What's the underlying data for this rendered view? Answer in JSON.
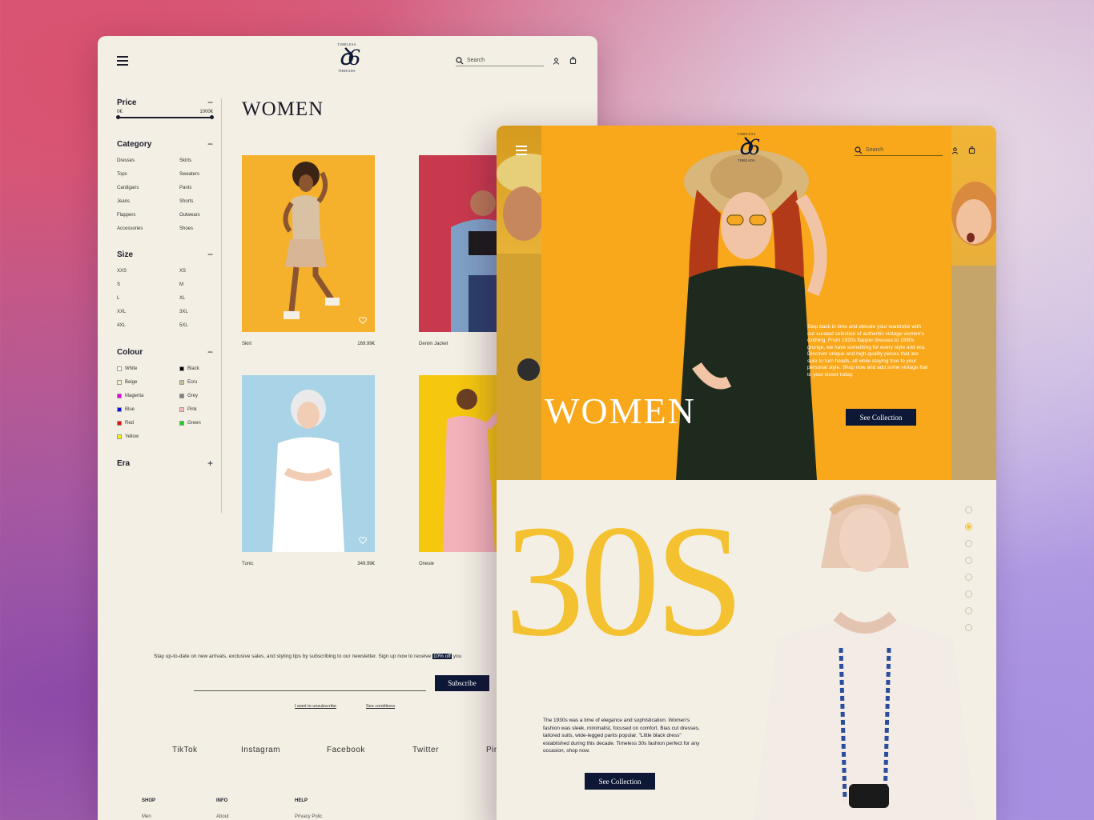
{
  "back": {
    "header": {
      "logo_top": "TIMELESS",
      "logo_mark": "ꝺ6",
      "logo_bottom": "THREADS",
      "search_placeholder": "Search"
    },
    "filters": {
      "price": {
        "title": "Price",
        "toggle": "−",
        "min": "0€",
        "max": "1000€"
      },
      "category": {
        "title": "Category",
        "toggle": "−",
        "items": [
          "Dresses",
          "Skirts",
          "Tops",
          "Sweaters",
          "Cardigans",
          "Pants",
          "Jeans",
          "Shorts",
          "Flappers",
          "Outwears",
          "Accessories",
          "Shoes"
        ]
      },
      "size": {
        "title": "Size",
        "toggle": "−",
        "items": [
          "XXS",
          "XS",
          "S",
          "M",
          "L",
          "XL",
          "XXL",
          "3XL",
          "4XL",
          "5XL"
        ]
      },
      "colour": {
        "title": "Colour",
        "toggle": "−",
        "items": [
          {
            "label": "White",
            "color": "#ffffff"
          },
          {
            "label": "Black",
            "color": "#000000"
          },
          {
            "label": "Beige",
            "color": "#f2ead2"
          },
          {
            "label": "Ecru",
            "color": "#c9bf9a"
          },
          {
            "label": "Magenta",
            "color": "#e000d8"
          },
          {
            "label": "Grey",
            "color": "#808080"
          },
          {
            "label": "Blue",
            "color": "#0a10e0"
          },
          {
            "label": "Pink",
            "color": "#f6b9c8"
          },
          {
            "label": "Red",
            "color": "#e01010"
          },
          {
            "label": "Green",
            "color": "#19d219"
          },
          {
            "label": "Yellow",
            "color": "#f5f218"
          }
        ]
      },
      "era": {
        "title": "Era",
        "toggle": "+"
      }
    },
    "category_title": "WOMEN",
    "products": [
      {
        "name": "Skirt",
        "price": "169.99€",
        "bg": "#f6b12c"
      },
      {
        "name": "Denim Jacket",
        "price": "",
        "bg": "#c8394e"
      },
      {
        "name": "Tunic",
        "price": "349.99€",
        "bg": "#a9d3e6"
      },
      {
        "name": "Onesie",
        "price": "",
        "bg": "#f5c70f"
      }
    ],
    "newsletter": {
      "text": "Stay up-to-date on new arrivals, exclusive sales, and styling tips by subscribing to our newsletter. Sign up now to receive",
      "highlight": "10% off",
      "tail": "you",
      "subscribe": "Subscribe",
      "unsubscribe": "I want to unsubscribe",
      "conditions": "See conditions"
    },
    "social": [
      "TikTok",
      "Instagram",
      "Facebook",
      "Twitter",
      "Pin"
    ],
    "footer": {
      "shop": "SHOP",
      "info": "INFO",
      "help": "HELP",
      "shop_first": "Men",
      "info_first": "About",
      "help_first": "Privacy Polic"
    }
  },
  "front": {
    "header": {
      "logo_top": "TIMELESS",
      "logo_mark": "ꝺ6",
      "logo_bottom": "THREADS",
      "search_placeholder": "Search"
    },
    "hero": {
      "title": "WOMEN",
      "text": "Step back in time and elevate your wardrobe with our curated selection of authentic vintage women's clothing. From 1920s flapper dresses to 1990s grunge, we have something for every style and era. Discover unique and high-quality pieces that are sure to turn heads, all while staying true to your personal style. Shop now and add some vintage flair to your closet today.",
      "button": "See Collection"
    },
    "era": {
      "big": "30S",
      "active_dot": 2,
      "dot_count": 8,
      "description": "The 1930s was a time of elegance and sophistication. Women's fashion was sleek, minimalist, focused on comfort. Bias cut dresses, tailored suits, wide-legged pants popular. \"Little black dress\" established during this decade. Timeless 30s fashion perfect for any occasion, shop now.",
      "button": "See Collection"
    }
  }
}
